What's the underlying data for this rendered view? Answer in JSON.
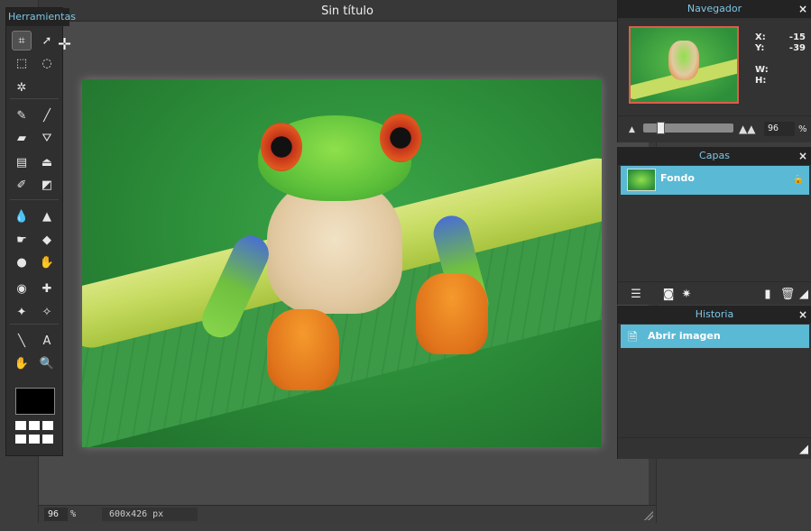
{
  "document": {
    "title": "Sin título",
    "zoom": "96",
    "zoom_unit": "%",
    "size": "600x426 px"
  },
  "tools": {
    "header": "Herramientas",
    "items": [
      {
        "name": "crop",
        "icon": "crop-icon",
        "glyph": "⌗",
        "active": true
      },
      {
        "name": "move",
        "icon": "move-icon",
        "glyph": "➚",
        "active": false
      },
      {
        "name": "marquee",
        "icon": "rect-select-icon",
        "glyph": "⬚",
        "active": false
      },
      {
        "name": "lasso",
        "icon": "lasso-icon",
        "glyph": "◌",
        "active": false
      },
      {
        "name": "magic-wand",
        "icon": "magic-wand-icon",
        "glyph": "✲",
        "active": false
      },
      {
        "name": "pencil",
        "icon": "pencil-icon",
        "glyph": "✎",
        "active": false
      },
      {
        "name": "brush",
        "icon": "brush-icon",
        "glyph": "╱",
        "active": false
      },
      {
        "name": "eraser",
        "icon": "eraser-icon",
        "glyph": "▰",
        "active": false
      },
      {
        "name": "paint-bucket",
        "icon": "bucket-icon",
        "glyph": "⛛",
        "active": false
      },
      {
        "name": "gradient",
        "icon": "gradient-icon",
        "glyph": "▤",
        "active": false
      },
      {
        "name": "clone-stamp",
        "icon": "stamp-icon",
        "glyph": "⏏",
        "active": false
      },
      {
        "name": "color-replace",
        "icon": "color-replace-icon",
        "glyph": "✐",
        "active": false
      },
      {
        "name": "shape",
        "icon": "shape-icon",
        "glyph": "◩",
        "active": false
      },
      {
        "name": "blur",
        "icon": "blur-drop-icon",
        "glyph": "💧",
        "active": false
      },
      {
        "name": "sharpen",
        "icon": "sharpen-icon",
        "glyph": "▲",
        "active": false
      },
      {
        "name": "smudge",
        "icon": "smudge-icon",
        "glyph": "☛",
        "active": false
      },
      {
        "name": "sponge",
        "icon": "sponge-icon",
        "glyph": "◆",
        "active": false
      },
      {
        "name": "burn",
        "icon": "burn-icon",
        "glyph": "●",
        "active": false
      },
      {
        "name": "dodge",
        "icon": "dodge-icon",
        "glyph": "✋",
        "active": false
      },
      {
        "name": "red-eye",
        "icon": "red-eye-icon",
        "glyph": "◉",
        "active": false
      },
      {
        "name": "spot-heal",
        "icon": "bandage-icon",
        "glyph": "✚",
        "active": false
      },
      {
        "name": "bloat",
        "icon": "bloat-icon",
        "glyph": "✦",
        "active": false
      },
      {
        "name": "pinch",
        "icon": "pinch-icon",
        "glyph": "✧",
        "active": false
      },
      {
        "name": "color-picker",
        "icon": "eyedropper-icon",
        "glyph": "╲",
        "active": false
      },
      {
        "name": "type",
        "icon": "type-icon",
        "glyph": "A",
        "active": false
      },
      {
        "name": "hand",
        "icon": "hand-icon",
        "glyph": "✋",
        "active": false
      },
      {
        "name": "zoom",
        "icon": "zoom-icon",
        "glyph": "🔍",
        "active": false
      }
    ],
    "foreground_color": "#000000"
  },
  "navigator": {
    "header": "Navegador",
    "close": "×",
    "x_label": "X:",
    "x_value": "-15",
    "y_label": "Y:",
    "y_value": "-39",
    "w_label": "W:",
    "w_value": "",
    "h_label": "H:",
    "h_value": "",
    "zoom": "96",
    "zoom_unit": "%",
    "zoom_fraction": 0.15
  },
  "layers": {
    "header": "Capas",
    "close": "×",
    "items": [
      {
        "name": "Fondo",
        "locked": true
      }
    ]
  },
  "history": {
    "header": "Historia",
    "close": "×",
    "items": [
      {
        "label": "Abrir imagen"
      }
    ]
  },
  "colors": {
    "accent": "#5ab9d5",
    "header_text": "#7ec6e6",
    "nav_frame": "#e05c4a"
  }
}
